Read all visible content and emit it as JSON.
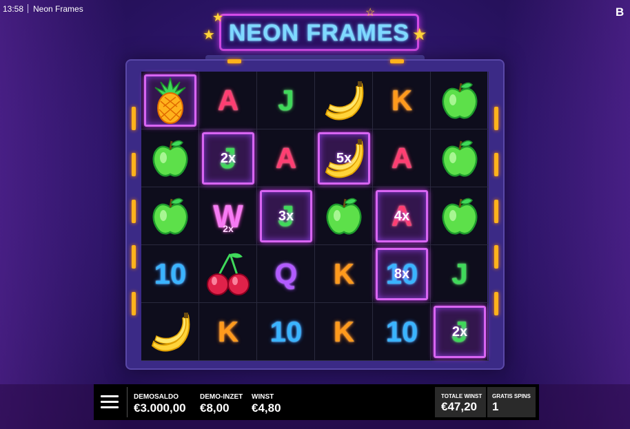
{
  "topbar": {
    "time": "13:58",
    "title": "Neon Frames",
    "brand": "B"
  },
  "logo": {
    "text": "NEON FRAMES"
  },
  "reels": [
    [
      {
        "sym": "pineapple",
        "frame": true
      },
      {
        "sym": "A"
      },
      {
        "sym": "J"
      },
      {
        "sym": "banana"
      },
      {
        "sym": "K"
      },
      {
        "sym": "apple"
      }
    ],
    [
      {
        "sym": "apple"
      },
      {
        "sym": "J",
        "frame": true,
        "mult": "2x"
      },
      {
        "sym": "A"
      },
      {
        "sym": "banana",
        "frame": true,
        "mult": "5x"
      },
      {
        "sym": "A"
      },
      {
        "sym": "apple"
      }
    ],
    [
      {
        "sym": "apple"
      },
      {
        "sym": "W",
        "wild_mult": "2x"
      },
      {
        "sym": "J",
        "frame": true,
        "mult": "3x"
      },
      {
        "sym": "apple"
      },
      {
        "sym": "A",
        "frame": true,
        "mult": "4x"
      },
      {
        "sym": "apple"
      }
    ],
    [
      {
        "sym": "10"
      },
      {
        "sym": "cherry"
      },
      {
        "sym": "Q"
      },
      {
        "sym": "K"
      },
      {
        "sym": "10",
        "frame": true,
        "mult": "8x"
      },
      {
        "sym": "J"
      }
    ],
    [
      {
        "sym": "banana"
      },
      {
        "sym": "K"
      },
      {
        "sym": "10"
      },
      {
        "sym": "K"
      },
      {
        "sym": "10"
      },
      {
        "sym": "J",
        "frame": true,
        "mult": "2x"
      }
    ]
  ],
  "bottom": {
    "demosaldo_label": "DEMOSALDO",
    "demosaldo_value": "€3.000,00",
    "inzet_label": "DEMO-INZET",
    "inzet_value": "€8,00",
    "winst_label": "WINST",
    "winst_value": "€4,80",
    "totale_label": "TOTALE WINST",
    "totale_value": "€47,20",
    "gratis_label": "GRATIS SPINS",
    "gratis_value": "1"
  },
  "icons": [
    "menu-icon",
    "star-icon",
    "pineapple-icon",
    "banana-icon",
    "apple-icon",
    "cherry-icon"
  ]
}
